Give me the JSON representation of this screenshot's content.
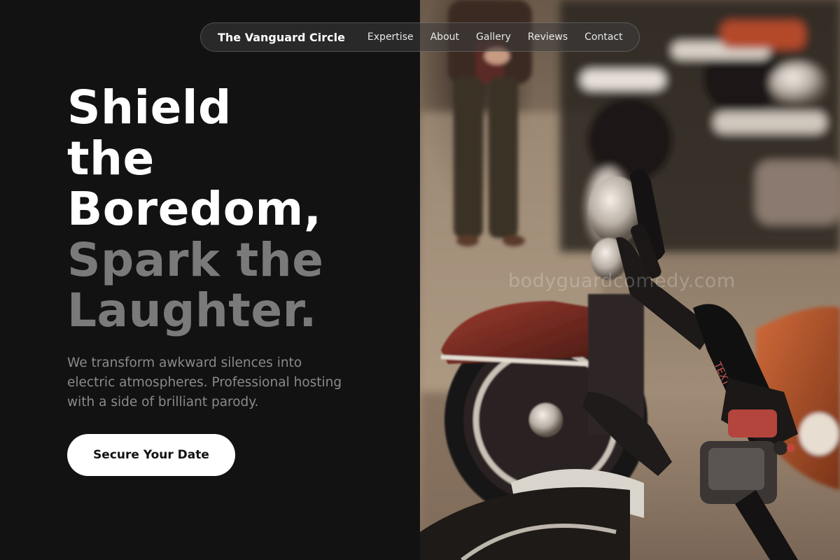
{
  "nav": {
    "brand": "The Vanguard Circle",
    "links": [
      "Expertise",
      "About",
      "Gallery",
      "Reviews",
      "Contact"
    ]
  },
  "hero": {
    "headline_lines": [
      "Shield",
      "the",
      "Boredom,",
      "Spark the",
      "Laughter."
    ],
    "subtext": "We transform awkward silences into electric atmospheres. Professional hosting with a side of brilliant parody.",
    "cta_label": "Secure Your Date"
  },
  "photo": {
    "watermark": "bodyguardcomedy.com",
    "subject": "motorcycles-parked-in-a-row"
  },
  "colors": {
    "background": "#121212",
    "headline_primary": "#ffffff",
    "headline_secondary": "#7a7a7a",
    "subtext": "#8a8a8a",
    "cta_background": "#ffffff",
    "cta_text": "#121212"
  }
}
